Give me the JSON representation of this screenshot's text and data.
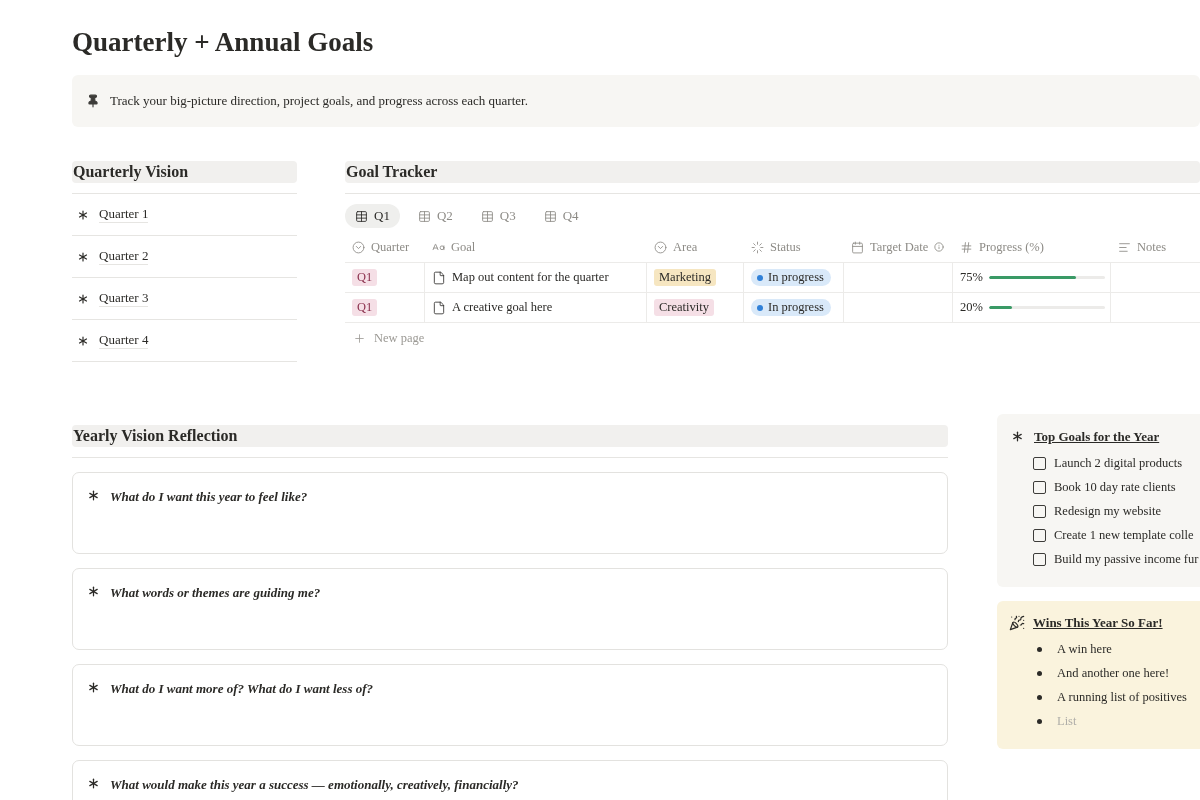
{
  "title": "Quarterly + Annual Goals",
  "callout": {
    "text": "Track your big-picture direction, project goals, and progress across each quarter."
  },
  "quarterly_vision": {
    "heading": "Quarterly Vision",
    "items": [
      "Quarter 1",
      "Quarter 2",
      "Quarter 3",
      "Quarter 4"
    ]
  },
  "goal_tracker": {
    "heading": "Goal Tracker",
    "tabs": [
      {
        "label": "Q1",
        "selected": true
      },
      {
        "label": "Q2",
        "selected": false
      },
      {
        "label": "Q3",
        "selected": false
      },
      {
        "label": "Q4",
        "selected": false
      }
    ],
    "columns": [
      {
        "label": "Quarter",
        "kind": "select"
      },
      {
        "label": "Goal",
        "kind": "title"
      },
      {
        "label": "Area",
        "kind": "select"
      },
      {
        "label": "Status",
        "kind": "status"
      },
      {
        "label": "Target Date",
        "kind": "date"
      },
      {
        "label": "Progress (%)",
        "kind": "number"
      },
      {
        "label": "Notes",
        "kind": "text"
      }
    ],
    "rows": [
      {
        "quarter": {
          "text": "Q1",
          "color": "#f5dfe6"
        },
        "goal": "Map out content for the quarter",
        "area": {
          "text": "Marketing",
          "color": "#f6e6c1"
        },
        "status": {
          "text": "In progress",
          "color": "#2f80d8"
        },
        "progress": {
          "text": "75%",
          "level": 0.75
        }
      },
      {
        "quarter": {
          "text": "Q1",
          "color": "#f5dfe6"
        },
        "goal": "A creative goal here",
        "area": {
          "text": "Creativity",
          "color": "#f5dfe6"
        },
        "status": {
          "text": "In progress",
          "color": "#2f80d8"
        },
        "progress": {
          "text": "20%",
          "level": 0.2
        }
      }
    ],
    "new_row": "New page"
  },
  "yearly_reflection": {
    "heading": "Yearly Vision Reflection",
    "questions": [
      "What do I want this year to feel like?",
      "What words or themes are guiding me?",
      "What do I want more of? What do I want less of?",
      "What would make this year a success — emotionally, creatively, financially?"
    ]
  },
  "top_goals": {
    "heading": "Top Goals for the Year",
    "items": [
      {
        "text": "Launch 2 digital products",
        "checked": false
      },
      {
        "text": "Book 10 day rate clients",
        "checked": false
      },
      {
        "text": "Redesign my website",
        "checked": false
      },
      {
        "text": "Create 1 new template colle",
        "checked": false
      },
      {
        "text": "Build my passive income fur",
        "checked": false
      }
    ]
  },
  "wins": {
    "heading": "Wins This Year So Far!",
    "items": [
      {
        "text": "A win here",
        "empty": false
      },
      {
        "text": "And another one here!",
        "empty": false
      },
      {
        "text": "A running list of positives",
        "empty": false
      },
      {
        "text": "List",
        "empty": true
      }
    ]
  }
}
